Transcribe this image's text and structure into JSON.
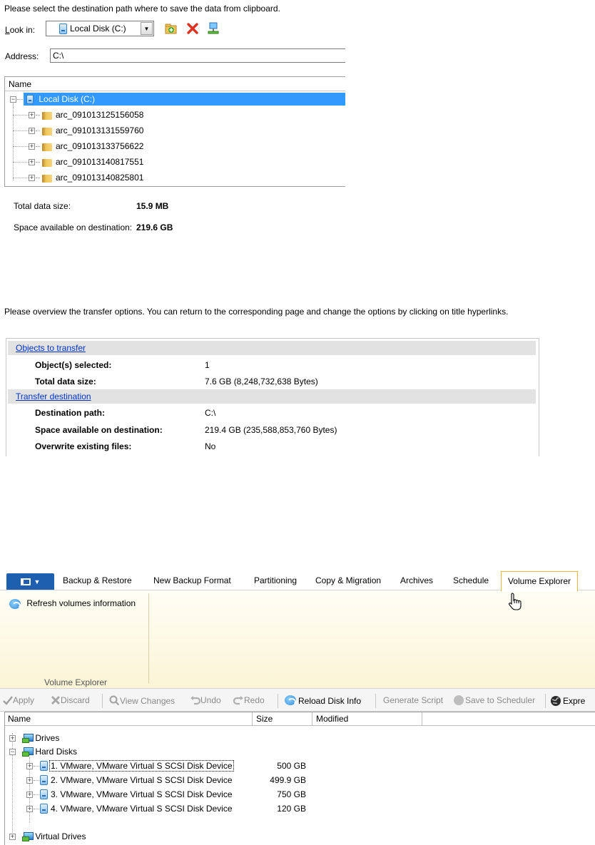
{
  "clipboard_dialog": {
    "instruction": "Please select the destination path where to save the data from clipboard.",
    "look_in_label": "Look in:",
    "look_in_value": "Local Disk (C:)",
    "address_label": "Address:",
    "address_value": "C:\\",
    "tree_column": "Name",
    "root": "Local Disk (C:)",
    "folders": [
      "arc_091013125156058",
      "arc_091013131559760",
      "arc_091013133756622",
      "arc_091013140817551",
      "arc_091013140825801"
    ],
    "total_size_label": "Total data size:",
    "total_size_value": "15.9 MB",
    "space_label": "Space available on destination:",
    "space_value": "219.6 GB"
  },
  "transfer_summary": {
    "instruction": "Please overview the transfer options. You can return to the corresponding page and change the options by clicking on title hyperlinks.",
    "sections": [
      {
        "title": "Objects to transfer",
        "rows": [
          {
            "label": "Object(s) selected:",
            "value": "1"
          },
          {
            "label": "Total data size:",
            "value": "7.6 GB (8,248,732,638 Bytes)"
          }
        ]
      },
      {
        "title": "Transfer destination",
        "rows": [
          {
            "label": "Destination path:",
            "value": "C:\\"
          },
          {
            "label": "Space available on destination:",
            "value": "219.4 GB (235,588,853,760 Bytes)"
          },
          {
            "label": "Overwrite existing files:",
            "value": "No"
          }
        ]
      }
    ]
  },
  "volume_explorer": {
    "tabs": [
      "Backup & Restore",
      "New Backup Format",
      "Partitioning",
      "Copy & Migration",
      "Archives",
      "Schedule",
      "Volume Explorer"
    ],
    "ribbon_button": "Refresh volumes information",
    "ribbon_group": "Volume Explorer",
    "toolbar": {
      "apply": "Apply",
      "discard": "Discard",
      "view_changes": "View Changes",
      "undo": "Undo",
      "redo": "Redo",
      "reload": "Reload Disk Info",
      "generate_script": "Generate Script",
      "save_scheduler": "Save to Scheduler",
      "express": "Expre"
    },
    "columns": [
      "Name",
      "Size",
      "Modified"
    ],
    "tree": {
      "drives": "Drives",
      "hard_disks": "Hard Disks",
      "disks": [
        {
          "name": "1. VMware, VMware Virtual S SCSI Disk Device",
          "size": "500 GB"
        },
        {
          "name": "2. VMware, VMware Virtual S SCSI Disk Device",
          "size": "499.9 GB"
        },
        {
          "name": "3. VMware, VMware Virtual S SCSI Disk Device",
          "size": "750 GB"
        },
        {
          "name": "4. VMware, VMware Virtual S SCSI Disk Device",
          "size": "120 GB"
        }
      ],
      "virtual_drives": "Virtual Drives"
    }
  },
  "colors": {
    "selection": "#3399ff",
    "link": "#0033cc",
    "menu_button": "#1f5fb0",
    "active_tab_border": "#e6b93b"
  }
}
